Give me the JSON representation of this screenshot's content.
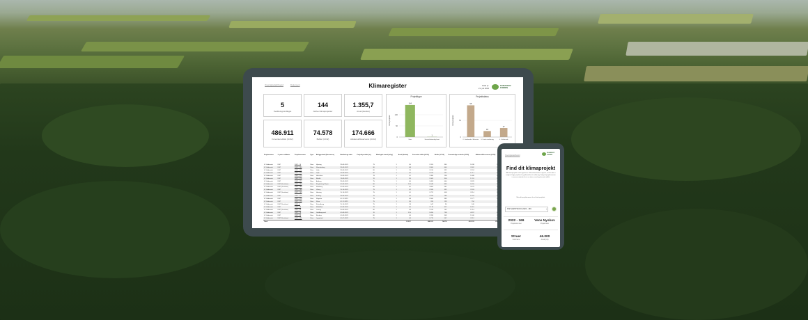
{
  "tablet": {
    "nav_links": [
      "Oversigtsdashboard",
      "Dokument"
    ],
    "title": "Klimaregister",
    "data_label": "Data pr.",
    "data_date": "21. juli 2023",
    "logo_text": [
      "KLIMASKOV",
      "FONDEN"
    ],
    "kpis": [
      {
        "value": "5",
        "label": "Kvalitetsgrundlaget"
      },
      {
        "value": "144",
        "label": "Aktive klimaprojekter"
      },
      {
        "value": "1.355,7",
        "label": "Areal (Hektar)"
      },
      {
        "value": "486.911",
        "label": "Forventet effekt (tCO2)"
      },
      {
        "value": "74.578",
        "label": "Buffer (tCO2)"
      },
      {
        "value": "174.666",
        "label": "Allokeret/Reserveret (tCO2)"
      }
    ],
    "table": {
      "headers": [
        "Projektstatus",
        "2. parts validator",
        "Projektnummer",
        "Type",
        "Beliggenhed (Kommune)",
        "Etablerings-dato",
        "Projekt-periode (år)",
        "Økologisk stand (årlig)",
        "Areal (Hektar)",
        "Forventet effekt (tCO2)",
        "Buffer (tCO2)",
        "Omsættelige enheder (tCO2)",
        "Allokeret/Reserveret (tCO2)",
        "Ledige (tCO2)"
      ],
      "rows": [
        [
          "4. Validerede",
          "KSP",
          "2022 - 14",
          "Skov",
          "Hjørring",
          "29-09-2023",
          "75",
          "1",
          "5,5",
          "2.203",
          "365",
          "1.838",
          "1.838",
          "0"
        ],
        [
          "4. Validerede",
          "KSP",
          "2022 - 109",
          "Skov",
          "Skanderborg",
          "29-09-2023",
          "80",
          "1",
          "6,8",
          "2.806",
          "444",
          "2.362",
          "2.362",
          "0"
        ],
        [
          "4. Validerede",
          "KSP",
          "2022 - 114",
          "Skov",
          "Vejle",
          "29-09-2023",
          "90",
          "1",
          "7,6",
          "2.616",
          "392",
          "2.224",
          "2.224",
          "0"
        ],
        [
          "4. Validerede",
          "KSP",
          "2022 - 116",
          "Skov",
          "Vejle",
          "16-09-2023",
          "80",
          "1",
          "4,2",
          "2.014",
          "297",
          "1.717",
          "1.717",
          "0"
        ],
        [
          "4. Validerede",
          "KSP",
          "2022 - 170",
          "Skov",
          "Holstebro",
          "16-09-2023",
          "78",
          "1",
          "5,1",
          "1.986",
          "298",
          "1.688",
          "1.688",
          "0"
        ],
        [
          "4. Validerede",
          "KSP",
          "2022 - 176",
          "Skov",
          "Rebild",
          "13-09-2023",
          "70",
          "1",
          "5,5",
          "2.005",
          "304",
          "1.701",
          "1.701",
          "0"
        ],
        [
          "4. Validerede",
          "KSP",
          "2022 - 177",
          "Skov",
          "Aalborg",
          "29-09-2023",
          "75",
          "1",
          "6,5",
          "3.493",
          "664",
          "2.829",
          "2.829",
          "0"
        ],
        [
          "4. Validerede",
          "KSP (Vestskov)",
          "2022 - 199",
          "Skov",
          "Ringkøbing-Skjern",
          "01-09-2023",
          "80",
          "1",
          "12,3",
          "6.048",
          "893",
          "5.155",
          "5.155",
          "0"
        ],
        [
          "4. Validerede",
          "KSP (Vestskov)",
          "2022 - 198",
          "Skov",
          "Silkeborg",
          "01-09-2023",
          "80",
          "1",
          "8,1",
          "3.860",
          "581",
          "3.279",
          "3.279",
          "0"
        ],
        [
          "4. Validerede",
          "KSP",
          "2022 - 168",
          "Skov",
          "Viborg",
          "15-10-2023",
          "75",
          "1",
          "5,2",
          "2.595",
          "392",
          "2.203",
          "2.203",
          "0"
        ],
        [
          "4. Validerede",
          "KSP (Vestskov)",
          "2022 - 169",
          "Skov",
          "Herning",
          "15-10-2023",
          "75",
          "1",
          "5,1",
          "2.722",
          "408",
          "2.314",
          "2.314",
          "0"
        ],
        [
          "4. Validerede",
          "KSP",
          "2022 - 173",
          "Skov",
          "Kolding",
          "29-09-2023",
          "75",
          "1",
          "5,1",
          "1.913",
          "289",
          "1.624",
          "1.624",
          "0"
        ],
        [
          "4. Validerede",
          "KSP",
          "2022 - 175",
          "Skov",
          "Slagelse",
          "01-11-2023",
          "75",
          "1",
          "4,8",
          "2.560",
          "383",
          "2.177",
          "2.177",
          "0"
        ],
        [
          "4. Validerede",
          "KSP",
          "2022 - 179",
          "Skov",
          "Skive",
          "01-11-2023",
          "75",
          "1",
          "3,6",
          "933",
          "139",
          "794",
          "0",
          "794"
        ],
        [
          "4. Validerede",
          "KSP (Vestskov)",
          "2022 - 6",
          "Skov",
          "Kalundborg",
          "15-10-2023",
          "75",
          "1",
          "1,8",
          "642",
          "96",
          "546",
          "0",
          "546"
        ],
        [
          "4. Validerede",
          "KSP",
          "2022 - 28",
          "Skov",
          "Middelfart",
          "01-09-2023",
          "75",
          "1",
          "5,0",
          "2.178",
          "327",
          "1.851",
          "1.851",
          "0"
        ],
        [
          "4. Validerede",
          "KSP (Vestskov)",
          "2022 - 35",
          "Skov",
          "Lemvig",
          "25-09-2023",
          "80",
          "1",
          "4,9",
          "1.376",
          "162",
          "1.214",
          "0",
          "1.214"
        ],
        [
          "4. Validerede",
          "KSP",
          "2022 - 74",
          "Skov",
          "Guldborgsund",
          "01-09-2023",
          "70",
          "1",
          "11,5",
          "5.055",
          "758",
          "4.297",
          "4.297",
          "0"
        ],
        [
          "4. Validerede",
          "KSP",
          "2022 - 98",
          "Skov",
          "Randers",
          "01-09-2023",
          "80",
          "1",
          "5,6",
          "2.288",
          "348",
          "1.940",
          "1.940",
          "0"
        ],
        [
          "4. Validerede",
          "KSP (Vestskov)",
          "2022 - 131",
          "Skov",
          "Lyngsbøvl",
          "01-07-2023",
          "75",
          "1",
          "4,3",
          "2.775",
          "567",
          "2.212",
          "2.212",
          "0"
        ]
      ],
      "total": [
        "Total",
        "",
        "",
        "",
        "",
        "",
        "",
        "",
        "1.355,7",
        "486.911",
        "74.578",
        "412.333",
        "174.666",
        "237.667"
      ]
    },
    "chart_data": [
      {
        "type": "bar",
        "title": "Projekttype",
        "categories": [
          "Skov",
          "Skovfuldstændig/urørt"
        ],
        "values": [
          144,
          1
        ],
        "data_labels": [
          "144",
          "1"
        ],
        "ylabel": "Antal projekter",
        "yticks": [
          0,
          50,
          100
        ],
        "ylim": [
          0,
          150
        ],
        "colors": [
          "#8fb75f",
          "#8fb75f"
        ]
      },
      {
        "type": "bar",
        "title": "Projektstatus",
        "categories": [
          "2. Godkendte / Afventer",
          "3. Under etablering",
          "4. Validerede"
        ],
        "values": [
          95,
          18,
          27
        ],
        "data_labels": [
          "95",
          "18",
          "27"
        ],
        "ylabel": "Antal projekter",
        "yticks": [
          0,
          50
        ],
        "ylim": [
          0,
          100
        ],
        "colors": [
          "#c3a98b",
          "#c3a98b",
          "#c3a98b"
        ]
      }
    ]
  },
  "phone": {
    "nav_link": "Oversigtsdashboard",
    "logo_text": [
      "KLIMASKOV",
      "FONDEN"
    ],
    "title": "Find dit klimaprojekt",
    "intro": "Alle klimaprojekter skal registreres i Klimaskovfondens register, hvorfra det er muligt at følge projektet fra godkendelse til validering. Vælg dit projektnummer i menuen nedenfor for at se status, areal og forventet effekt.",
    "note": "Skriv dit projektnummer for at finde projektet.",
    "select_value": "KSP (VESTSKOV) 2022 - 169",
    "stats": [
      {
        "value": "2022 - 169",
        "label": "Projektnummer"
      },
      {
        "value": "Vene Nyskov",
        "label": "Projektnavn"
      },
      {
        "value": "Struer",
        "label": "Kommune"
      },
      {
        "value": "46.000",
        "label": "Areal (m2)"
      }
    ]
  }
}
